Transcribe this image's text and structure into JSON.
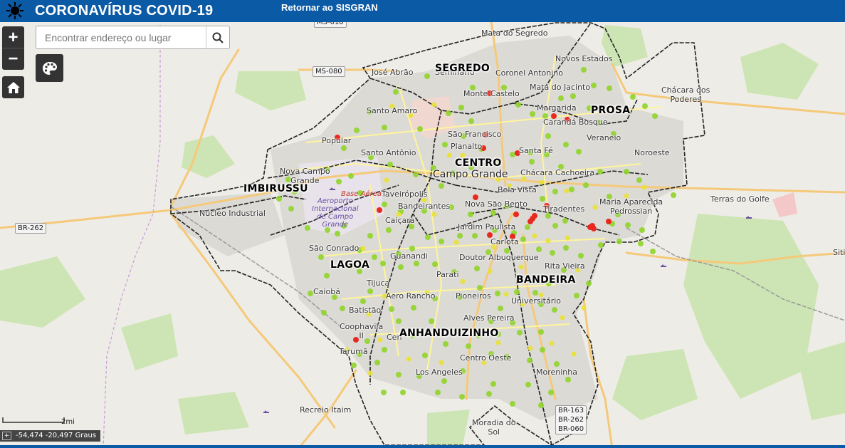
{
  "header": {
    "title": "CORONAVÍRUS COVID-19",
    "return_link": "Retornar ao SISGRAN"
  },
  "search": {
    "placeholder": "Encontrar endereço ou lugar",
    "value": ""
  },
  "controls": {
    "zoom_in": "+",
    "zoom_out": "−"
  },
  "scale": {
    "label": "2mi"
  },
  "coordinates": {
    "text": "-54,474 -20,497 Graus"
  },
  "regions": [
    "SEGREDO",
    "PROSA",
    "CENTRO",
    "IMBIRUSSU",
    "LAGOA",
    "BANDEIRA",
    "ANHANDUIZINHO"
  ],
  "places": {
    "mata_do_segredo": "Mata do Segredo",
    "novos_estados": "Novos Estados",
    "jose_abrao": "José Abrão",
    "seminario": "Seminário",
    "coronel_antonino": "Coronel Antonino",
    "mata_do_jacinto": "Mata do Jacinto",
    "monte_castelo": "Monte Castelo",
    "chacara_dos_poderes": "Chácara dos\nPoderes",
    "santo_amaro": "Santo Amaro",
    "margarida": "Margarida",
    "caranda_bosque": "Carandá Bosque",
    "veraneio": "Veraneio",
    "sao_francisco": "São Francisco",
    "popular": "Popular",
    "planalto": "Planalto",
    "santo_antonio": "Santo Antônio",
    "santa_fe": "Santa Fé",
    "noroeste": "Noroeste",
    "nova_campo_grande": "Nova Campo\nGrande",
    "campo_grande": "Campo Grande",
    "chacara_cachoeira": "Chácara Cachoeira",
    "bela_vista": "Bela Vista",
    "taveiropolis": "Taveirópolis",
    "maria_aparecida_pedrossian": "Maria Aparecida\nPedrossian",
    "terras_do_golfe": "Terras do Golfe",
    "bandeirantes": "Bandeirantes",
    "nova_sao_bento": "Nova São Bento",
    "tiradentes": "Tiradentes",
    "nucleo_industrial": "Núcleo Industrial",
    "caicara": "Caiçara",
    "jardim_paulista": "Jardim Paulista",
    "carlota": "Carlota",
    "sao_conrado": "São Conrado",
    "guanandi": "Guanandi",
    "doutor_albuquerque": "Doutor Albuquerque",
    "siti": "Siti",
    "rita_vieira": "Rita Vieira",
    "parati": "Parati",
    "caioba": "Caiobá",
    "tijuca": "Tijuca",
    "aero_rancho": "Aero Rancho",
    "pioneiros": "Pioneiros",
    "universitario": "Universitário",
    "batistao": "Batistão",
    "alves_pereira": "Alves Pereira",
    "coophavila": "Coophavila\nII",
    "centenario": "Cen",
    "taruma": "Tarumã",
    "centro_oeste": "Centro Oeste",
    "los_angeles": "Los Angeles",
    "moreninha": "Moreninha",
    "recreio_itaim": "Recreio Itaim",
    "moradia_do_sol": "Moradia do\nSol"
  },
  "roads": {
    "ms080": "MS-080",
    "ms010": "MS-010",
    "br262": "BR-262",
    "br_junction": "BR-163\nBR-262\nBR-060"
  },
  "airport": {
    "base_aerea": "Base Aérea",
    "aeroporto": "Aeroporto\nInternacional\nde Campo\nGrande"
  },
  "colors": {
    "header": "#0b5aa5",
    "green_case": "#8fd42a",
    "yellow_case": "#e8e23a",
    "red_case": "#e8291f",
    "region_border": "#222222"
  }
}
